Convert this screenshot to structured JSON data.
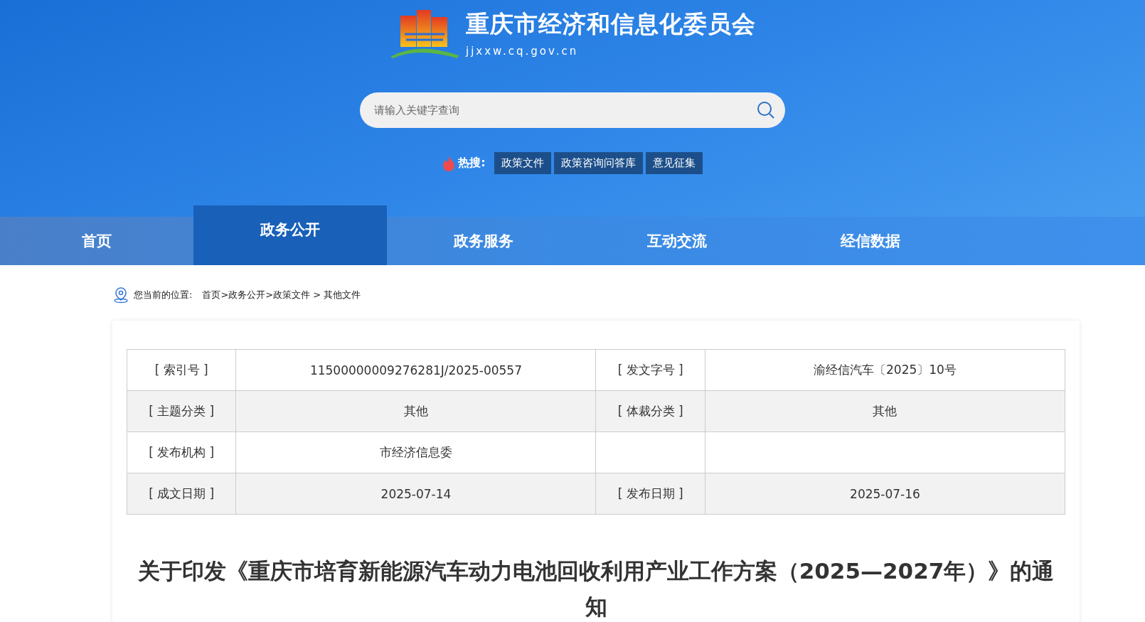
{
  "site": {
    "name": "重庆市经济和信息化委员会",
    "domain": "jjxxw.cq.gov.cn"
  },
  "search": {
    "placeholder": "请输入关键字查询"
  },
  "hot_search": {
    "label": "热搜:",
    "tags": [
      "政策文件",
      "政策咨询问答库",
      "意见征集"
    ]
  },
  "nav": [
    {
      "label": "首页",
      "selected": false
    },
    {
      "label": "政务公开",
      "selected": true
    },
    {
      "label": "政务服务",
      "selected": false
    },
    {
      "label": "互动交流",
      "selected": false
    },
    {
      "label": "经信数据",
      "selected": false
    }
  ],
  "breadcrumb": {
    "label": "您当前的位置:",
    "path": "首页>政务公开>政策文件 > 其他文件"
  },
  "info_table": [
    {
      "label_1": "[ 索引号 ]",
      "value_1": "11500000009276281J/2025-00557",
      "label_2": "[ 发文字号 ]",
      "value_2": "渝经信汽车〔2025〕10号"
    },
    {
      "label_1": "[ 主题分类 ]",
      "value_1": "其他",
      "label_2": "[ 体裁分类 ]",
      "value_2": "其他"
    },
    {
      "label_1": "[ 发布机构 ]",
      "value_1": "市经济信息委"
    },
    {
      "label_1": "[ 成文日期 ]",
      "value_1": "2025-07-14",
      "label_2": "[ 发布日期 ]",
      "value_2": "2025-07-16"
    }
  ],
  "article": {
    "title": "关于印发《重庆市培育新能源汽车动力电池回收利用产业工作方案（2025—2027年）》的通知"
  }
}
